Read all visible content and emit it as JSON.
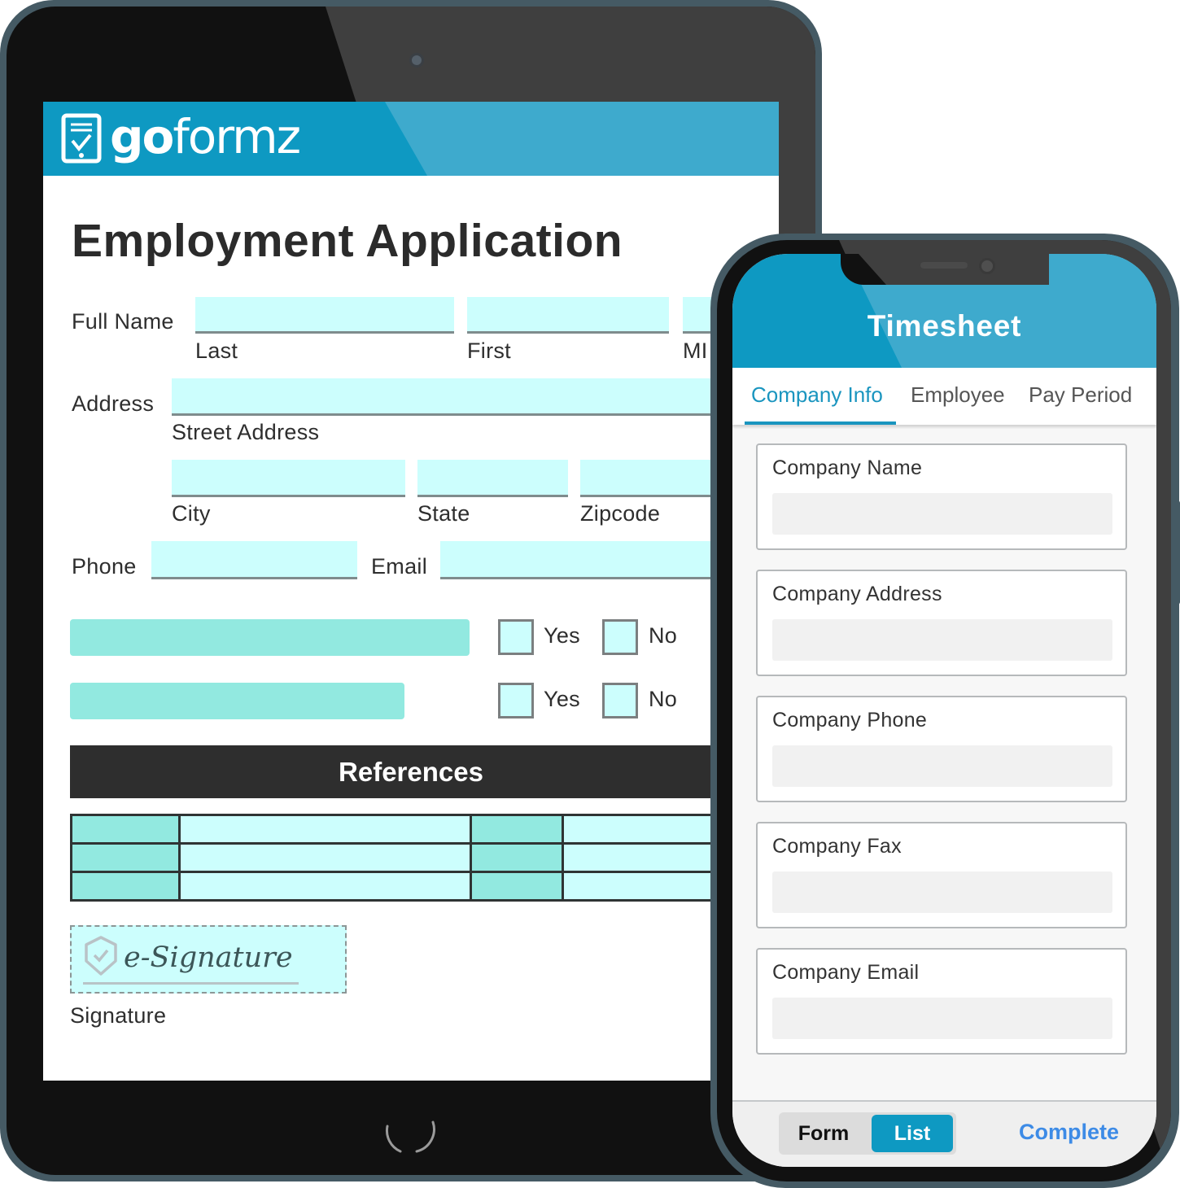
{
  "tablet": {
    "brand": {
      "bold": "go",
      "regular": "formz"
    },
    "form_title": "Employment Application",
    "fields": {
      "full_name_label": "Full Name",
      "last_label": "Last",
      "first_label": "First",
      "mi_label": "MI",
      "address_label": "Address",
      "street_label": "Street Address",
      "city_label": "City",
      "state_label": "State",
      "zip_label": "Zipcode",
      "phone_label": "Phone",
      "email_label": "Email"
    },
    "checkbox_rows": [
      {
        "yes_label": "Yes",
        "no_label": "No"
      },
      {
        "yes_label": "Yes",
        "no_label": "No"
      }
    ],
    "references_heading": "References",
    "references_rows": 3,
    "esignature_text": "e-Signature",
    "signature_label": "Signature"
  },
  "phone": {
    "title": "Timesheet",
    "tabs": [
      {
        "label": "Company Info",
        "active": true
      },
      {
        "label": "Employee",
        "active": false
      },
      {
        "label": "Pay Period",
        "active": false
      }
    ],
    "cards": [
      {
        "label": "Company Name",
        "value": ""
      },
      {
        "label": "Company Address",
        "value": ""
      },
      {
        "label": "Company Phone",
        "value": ""
      },
      {
        "label": "Company Fax",
        "value": ""
      },
      {
        "label": "Company Email",
        "value": ""
      }
    ],
    "footer": {
      "form_label": "Form",
      "list_label": "List",
      "selected": "List",
      "complete_label": "Complete"
    }
  },
  "colors": {
    "brand_blue": "#0e99c2",
    "field_fill": "#ccfefd",
    "teal_fill": "#92e9e0",
    "complete_blue": "#3d8be6"
  }
}
